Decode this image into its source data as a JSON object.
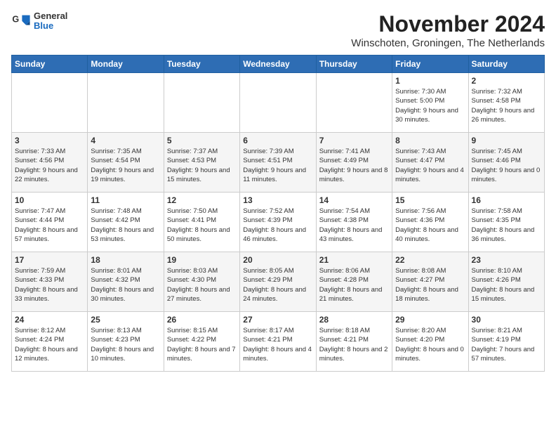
{
  "header": {
    "logo_line1": "General",
    "logo_line2": "Blue",
    "month_title": "November 2024",
    "location": "Winschoten, Groningen, The Netherlands"
  },
  "weekdays": [
    "Sunday",
    "Monday",
    "Tuesday",
    "Wednesday",
    "Thursday",
    "Friday",
    "Saturday"
  ],
  "weeks": [
    [
      {
        "day": "",
        "info": ""
      },
      {
        "day": "",
        "info": ""
      },
      {
        "day": "",
        "info": ""
      },
      {
        "day": "",
        "info": ""
      },
      {
        "day": "",
        "info": ""
      },
      {
        "day": "1",
        "info": "Sunrise: 7:30 AM\nSunset: 5:00 PM\nDaylight: 9 hours and 30 minutes."
      },
      {
        "day": "2",
        "info": "Sunrise: 7:32 AM\nSunset: 4:58 PM\nDaylight: 9 hours and 26 minutes."
      }
    ],
    [
      {
        "day": "3",
        "info": "Sunrise: 7:33 AM\nSunset: 4:56 PM\nDaylight: 9 hours and 22 minutes."
      },
      {
        "day": "4",
        "info": "Sunrise: 7:35 AM\nSunset: 4:54 PM\nDaylight: 9 hours and 19 minutes."
      },
      {
        "day": "5",
        "info": "Sunrise: 7:37 AM\nSunset: 4:53 PM\nDaylight: 9 hours and 15 minutes."
      },
      {
        "day": "6",
        "info": "Sunrise: 7:39 AM\nSunset: 4:51 PM\nDaylight: 9 hours and 11 minutes."
      },
      {
        "day": "7",
        "info": "Sunrise: 7:41 AM\nSunset: 4:49 PM\nDaylight: 9 hours and 8 minutes."
      },
      {
        "day": "8",
        "info": "Sunrise: 7:43 AM\nSunset: 4:47 PM\nDaylight: 9 hours and 4 minutes."
      },
      {
        "day": "9",
        "info": "Sunrise: 7:45 AM\nSunset: 4:46 PM\nDaylight: 9 hours and 0 minutes."
      }
    ],
    [
      {
        "day": "10",
        "info": "Sunrise: 7:47 AM\nSunset: 4:44 PM\nDaylight: 8 hours and 57 minutes."
      },
      {
        "day": "11",
        "info": "Sunrise: 7:48 AM\nSunset: 4:42 PM\nDaylight: 8 hours and 53 minutes."
      },
      {
        "day": "12",
        "info": "Sunrise: 7:50 AM\nSunset: 4:41 PM\nDaylight: 8 hours and 50 minutes."
      },
      {
        "day": "13",
        "info": "Sunrise: 7:52 AM\nSunset: 4:39 PM\nDaylight: 8 hours and 46 minutes."
      },
      {
        "day": "14",
        "info": "Sunrise: 7:54 AM\nSunset: 4:38 PM\nDaylight: 8 hours and 43 minutes."
      },
      {
        "day": "15",
        "info": "Sunrise: 7:56 AM\nSunset: 4:36 PM\nDaylight: 8 hours and 40 minutes."
      },
      {
        "day": "16",
        "info": "Sunrise: 7:58 AM\nSunset: 4:35 PM\nDaylight: 8 hours and 36 minutes."
      }
    ],
    [
      {
        "day": "17",
        "info": "Sunrise: 7:59 AM\nSunset: 4:33 PM\nDaylight: 8 hours and 33 minutes."
      },
      {
        "day": "18",
        "info": "Sunrise: 8:01 AM\nSunset: 4:32 PM\nDaylight: 8 hours and 30 minutes."
      },
      {
        "day": "19",
        "info": "Sunrise: 8:03 AM\nSunset: 4:30 PM\nDaylight: 8 hours and 27 minutes."
      },
      {
        "day": "20",
        "info": "Sunrise: 8:05 AM\nSunset: 4:29 PM\nDaylight: 8 hours and 24 minutes."
      },
      {
        "day": "21",
        "info": "Sunrise: 8:06 AM\nSunset: 4:28 PM\nDaylight: 8 hours and 21 minutes."
      },
      {
        "day": "22",
        "info": "Sunrise: 8:08 AM\nSunset: 4:27 PM\nDaylight: 8 hours and 18 minutes."
      },
      {
        "day": "23",
        "info": "Sunrise: 8:10 AM\nSunset: 4:26 PM\nDaylight: 8 hours and 15 minutes."
      }
    ],
    [
      {
        "day": "24",
        "info": "Sunrise: 8:12 AM\nSunset: 4:24 PM\nDaylight: 8 hours and 12 minutes."
      },
      {
        "day": "25",
        "info": "Sunrise: 8:13 AM\nSunset: 4:23 PM\nDaylight: 8 hours and 10 minutes."
      },
      {
        "day": "26",
        "info": "Sunrise: 8:15 AM\nSunset: 4:22 PM\nDaylight: 8 hours and 7 minutes."
      },
      {
        "day": "27",
        "info": "Sunrise: 8:17 AM\nSunset: 4:21 PM\nDaylight: 8 hours and 4 minutes."
      },
      {
        "day": "28",
        "info": "Sunrise: 8:18 AM\nSunset: 4:21 PM\nDaylight: 8 hours and 2 minutes."
      },
      {
        "day": "29",
        "info": "Sunrise: 8:20 AM\nSunset: 4:20 PM\nDaylight: 8 hours and 0 minutes."
      },
      {
        "day": "30",
        "info": "Sunrise: 8:21 AM\nSunset: 4:19 PM\nDaylight: 7 hours and 57 minutes."
      }
    ]
  ]
}
